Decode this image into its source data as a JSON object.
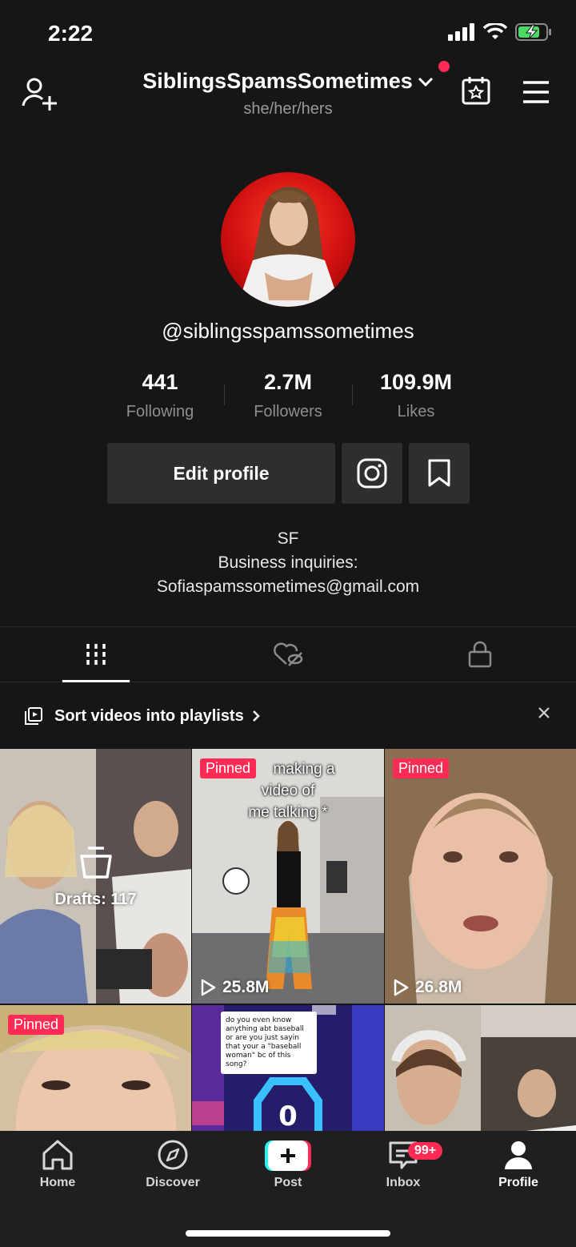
{
  "status_bar": {
    "time": "2:22"
  },
  "header": {
    "username": "SiblingsSpamsSometimes",
    "pronouns": "she/her/hers"
  },
  "profile": {
    "handle": "@siblingsspamssometimes",
    "stats": [
      {
        "value": "441",
        "label": "Following"
      },
      {
        "value": "2.7M",
        "label": "Followers"
      },
      {
        "value": "109.9M",
        "label": "Likes"
      }
    ],
    "edit_label": "Edit profile",
    "bio": [
      "SF",
      "Business inquiries:",
      "Sofiaspamssometimes@gmail.com"
    ]
  },
  "tabs": [
    "videos-grid-icon",
    "liked-hidden-icon",
    "lock-icon"
  ],
  "playlist_banner": {
    "text": "Sort videos into playlists"
  },
  "grid": {
    "drafts_label": "Drafts: 117",
    "items": [
      {
        "pinned": "",
        "views": ""
      },
      {
        "pinned": "Pinned",
        "views": "25.8M",
        "caption": [
          "making a",
          "video of",
          "me talking *"
        ]
      },
      {
        "pinned": "Pinned",
        "views": "26.8M"
      },
      {
        "pinned": "Pinned",
        "views": ""
      },
      {
        "pinned": "",
        "views": "",
        "comment": "do you even know anything abt baseball or are you just sayin that your a \"baseball woman\" bc of this song?"
      },
      {
        "pinned": "",
        "views": ""
      }
    ]
  },
  "nav": {
    "items": [
      "Home",
      "Discover",
      "Post",
      "Inbox",
      "Profile"
    ],
    "inbox_badge": "99+"
  },
  "colors": {
    "accent": "#fe2c55",
    "background": "#161616"
  }
}
